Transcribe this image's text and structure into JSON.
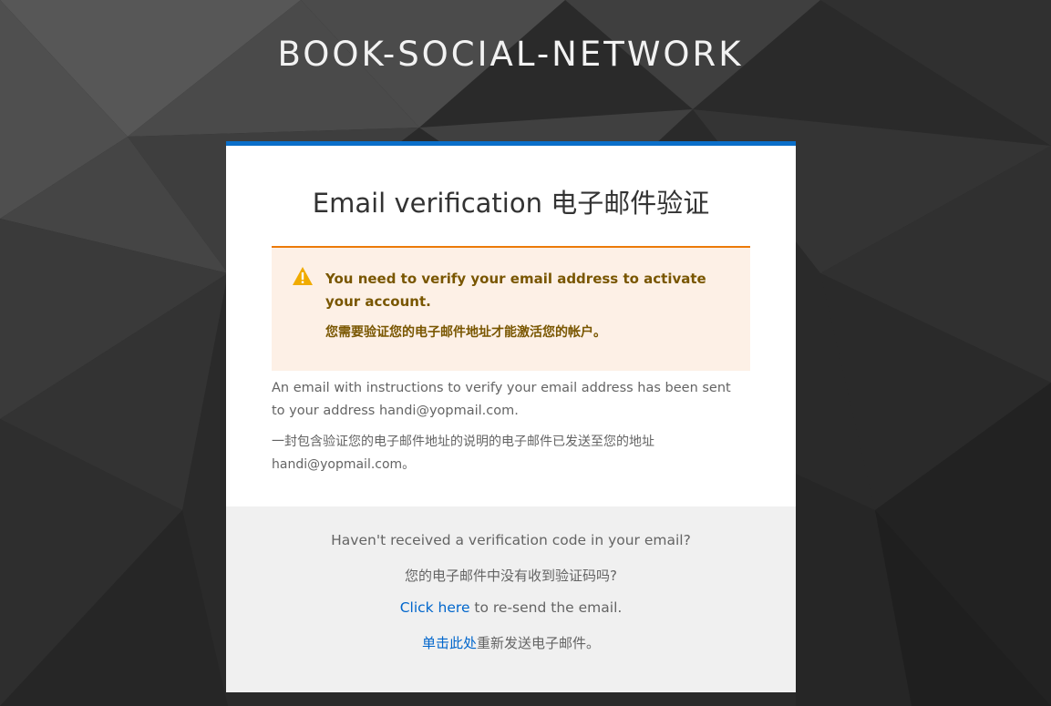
{
  "brand": {
    "title": "BOOK-SOCIAL-NETWORK"
  },
  "card": {
    "title": "Email verification 电子邮件验证",
    "alert": {
      "icon": "warning-triangle-icon",
      "message": "You need to verify your email address to activate your account.",
      "message_zh": "您需要验证您的电子邮件地址才能激活您的帐户。"
    },
    "info": "An email with instructions to verify your email address has been sent to your address handi@yopmail.com.",
    "info_zh": "一封包含验证您的电子邮件地址的说明的电子邮件已发送至您的地址 handi@yopmail.com。"
  },
  "footer": {
    "question": "Haven't received a verification code in your email?",
    "question_zh": "您的电子邮件中没有收到验证码吗?",
    "resend_link": "Click here",
    "resend_text": " to re-send the email.",
    "resend_link_zh": "单击此处",
    "resend_text_zh": "重新发送电子邮件。"
  },
  "colors": {
    "accent_bar": "#0b6fc9",
    "warning_border": "#ec7a08",
    "warning_bg": "#fdf0e6",
    "warning_text": "#795600",
    "link": "#0066cc"
  }
}
